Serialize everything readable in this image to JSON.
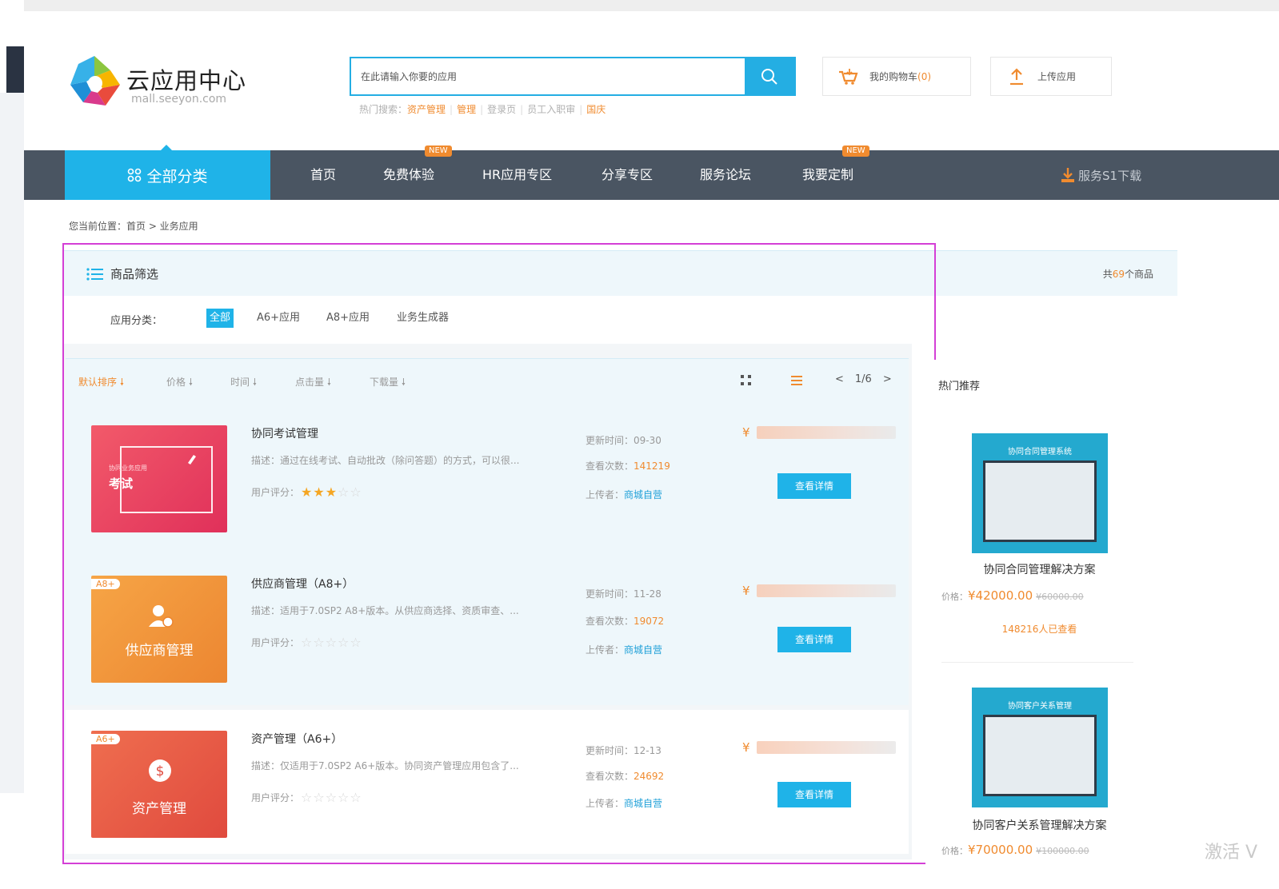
{
  "brand": {
    "title": "云应用中心",
    "subtitle": "mall.seeyon.com"
  },
  "search": {
    "placeholder": "在此请输入你要的应用",
    "hot_label": "热门搜索：",
    "hot_terms": [
      "资产管理",
      "管理",
      "登录页",
      "员工入职审",
      "国庆"
    ]
  },
  "header": {
    "cart_label": "我的购物车",
    "cart_count": "(0)",
    "upload_label": "上传应用"
  },
  "nav": {
    "all_label": "全部分类",
    "items": [
      "首页",
      "免费体验",
      "HR应用专区",
      "分享专区",
      "服务论坛",
      "我要定制"
    ],
    "new_badge": "NEW",
    "download_label": "服务S1下载"
  },
  "breadcrumb": "您当前位置：首页 > 业务应用",
  "filter": {
    "title": "商品筛选",
    "total_prefix": "共",
    "total_count": "69",
    "total_suffix": "个商品",
    "category_label": "应用分类：",
    "chips": [
      "全部",
      "A6+应用",
      "A8+应用",
      "业务生成器"
    ]
  },
  "sort": {
    "options": [
      "默认排序",
      "价格",
      "时间",
      "点击量",
      "下载量"
    ],
    "page_prev": "<",
    "page": "1/6",
    "page_next": ">"
  },
  "products": [
    {
      "name": "协同考试管理",
      "thumb_text": "考试",
      "thumb_sub": "协同业务应用",
      "thumb_tag": "",
      "desc": "描述：通过在线考试、自动批改（除问答题）的方式，可以很...",
      "rating_label": "用户评分：",
      "rating": 3,
      "update_label": "更新时间：",
      "update": "09-30",
      "views_label": "查看次数：",
      "views": "141219",
      "uploader_label": "上传者：",
      "uploader": "商城自营",
      "price_symbol": "¥",
      "button": "查看详情"
    },
    {
      "name": "供应商管理（A8+）",
      "thumb_text": "供应商管理",
      "thumb_tag": "A8+",
      "desc": "描述：适用于7.0SP2 A8+版本。从供应商选择、资质审查、...",
      "rating_label": "用户评分：",
      "rating": 0,
      "update_label": "更新时间：",
      "update": "11-28",
      "views_label": "查看次数：",
      "views": "19072",
      "uploader_label": "上传者：",
      "uploader": "商城自营",
      "price_symbol": "¥",
      "button": "查看详情"
    },
    {
      "name": "资产管理（A6+）",
      "thumb_text": "资产管理",
      "thumb_tag": "A6+",
      "desc": "描述：仅适用于7.0SP2 A6+版本。协同资产管理应用包含了...",
      "rating_label": "用户评分：",
      "rating": 0,
      "update_label": "更新时间：",
      "update": "12-13",
      "views_label": "查看次数：",
      "views": "24692",
      "uploader_label": "上传者：",
      "uploader": "商城自营",
      "price_symbol": "¥",
      "button": "查看详情"
    }
  ],
  "hot": {
    "title": "热门推荐",
    "items": [
      {
        "img_title": "协同合同管理系统",
        "name": "协同合同管理解决方案",
        "price_label": "价格：",
        "price": "¥42000.00",
        "old_price": "¥60000.00",
        "views": "148216人已查看"
      },
      {
        "img_title": "协同客户关系管理",
        "name": "协同客户关系管理解决方案",
        "price_label": "价格：",
        "price": "¥70000.00",
        "old_price": "¥100000.00",
        "views": ""
      }
    ]
  },
  "watermark": "激活 V",
  "colors": {
    "accent": "#1fb3e8",
    "orange": "#f08b2f",
    "nav": "#4a5562",
    "highlight": "#d43fd6"
  }
}
